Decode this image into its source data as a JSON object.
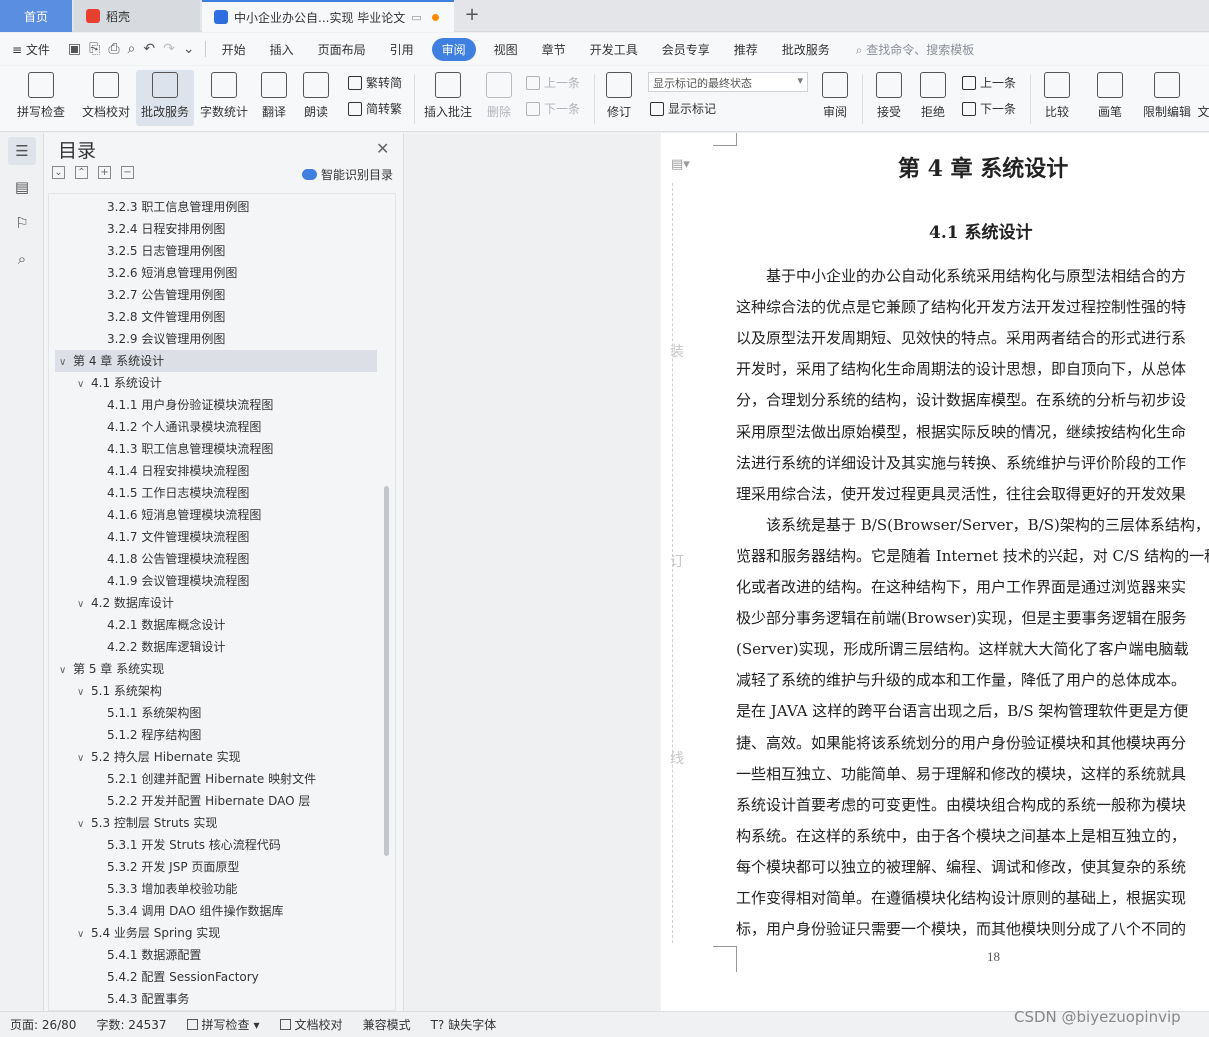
{
  "tabs": {
    "home": "首页",
    "daoke": "稻壳",
    "doc": "中小企业办公自...实现 毕业论文"
  },
  "menu": {
    "file": "文件",
    "items": [
      "开始",
      "插入",
      "页面布局",
      "引用",
      "审阅",
      "视图",
      "章节",
      "开发工具",
      "会员专享",
      "推荐",
      "批改服务"
    ],
    "active": "审阅",
    "search": "查找命令、搜索模板"
  },
  "ribbon": {
    "spell": "拼写检查",
    "proofread": "文档校对",
    "correction": "批改服务",
    "wordcount": "字数统计",
    "translate": "翻译",
    "read": "朗读",
    "to_simplified": "繁转简",
    "to_traditional": "简转繁",
    "insert_comment": "插入批注",
    "delete": "删除",
    "prev": "上一条",
    "next": "下一条",
    "revise": "修订",
    "markup_state": "显示标记的最终状态",
    "show_markup": "显示标记",
    "review": "审阅",
    "accept": "接受",
    "reject": "拒绝",
    "prev2": "上一条",
    "next2": "下一条",
    "compare": "比较",
    "pen": "画笔",
    "restrict": "限制编辑",
    "more": "文"
  },
  "toc": {
    "title": "目录",
    "smart": "智能识别目录",
    "items": [
      {
        "level": 3,
        "text": "3.2.3  职工信息管理用例图"
      },
      {
        "level": 3,
        "text": "3.2.4  日程安排用例图"
      },
      {
        "level": 3,
        "text": "3.2.5  日志管理用例图"
      },
      {
        "level": 3,
        "text": "3.2.6  短消息管理用例图"
      },
      {
        "level": 3,
        "text": "3.2.7  公告管理用例图"
      },
      {
        "level": 3,
        "text": "3.2.8  文件管理用例图"
      },
      {
        "level": 3,
        "text": "3.2.9  会议管理用例图"
      },
      {
        "level": 1,
        "text": "第 4 章  系统设计",
        "selected": true
      },
      {
        "level": 2,
        "text": "4.1  系统设计"
      },
      {
        "level": 3,
        "text": "4.1.1  用户身份验证模块流程图"
      },
      {
        "level": 3,
        "text": "4.1.2  个人通讯录模块流程图"
      },
      {
        "level": 3,
        "text": "4.1.3  职工信息管理模块流程图"
      },
      {
        "level": 3,
        "text": "4.1.4  日程安排模块流程图"
      },
      {
        "level": 3,
        "text": "4.1.5  工作日志模块流程图"
      },
      {
        "level": 3,
        "text": "4.1.6  短消息管理模块流程图"
      },
      {
        "level": 3,
        "text": "4.1.7  文件管理模块流程图"
      },
      {
        "level": 3,
        "text": "4.1.8  公告管理模块流程图"
      },
      {
        "level": 3,
        "text": "4.1.9  会议管理模块流程图"
      },
      {
        "level": 2,
        "text": "4.2  数据库设计"
      },
      {
        "level": 3,
        "text": "4.2.1  数据库概念设计"
      },
      {
        "level": 3,
        "text": "4.2.2  数据库逻辑设计"
      },
      {
        "level": 1,
        "text": "第 5 章  系统实现"
      },
      {
        "level": 2,
        "text": "5.1  系统架构"
      },
      {
        "level": 3,
        "text": "5.1.1  系统架构图"
      },
      {
        "level": 3,
        "text": "5.1.2  程序结构图"
      },
      {
        "level": 2,
        "text": "5.2  持久层 Hibernate 实现"
      },
      {
        "level": 3,
        "text": "5.2.1  创建并配置 Hibernate 映射文件"
      },
      {
        "level": 3,
        "text": "5.2.2  开发并配置 Hibernate DAO 层"
      },
      {
        "level": 2,
        "text": "5.3  控制层 Struts 实现"
      },
      {
        "level": 3,
        "text": "5.3.1  开发 Struts 核心流程代码"
      },
      {
        "level": 3,
        "text": "5.3.2  开发 JSP 页面原型"
      },
      {
        "level": 3,
        "text": "5.3.3  增加表单校验功能"
      },
      {
        "level": 3,
        "text": "5.3.4  调用 DAO 组件操作数据库"
      },
      {
        "level": 2,
        "text": "5.4  业务层 Spring 实现"
      },
      {
        "level": 3,
        "text": "5.4.1  数据源配置"
      },
      {
        "level": 3,
        "text": "5.4.2  配置 SessionFactory"
      },
      {
        "level": 3,
        "text": "5.4.3  配置事务"
      }
    ]
  },
  "document": {
    "chapter": "第 4 章  系统设计",
    "section": "4.1  系统设计",
    "binding": [
      "装",
      "订",
      "线"
    ],
    "lines": [
      "　　基于中小企业的办公自动化系统采用结构化与原型法相结合的方",
      "这种综合法的优点是它兼顾了结构化开发方法开发过程控制性强的特",
      "以及原型法开发周期短、见效快的特点。采用两者结合的形式进行系",
      "开发时，采用了结构化生命周期法的设计思想，即自顶向下，从总体",
      "分，合理划分系统的结构，设计数据库模型。在系统的分析与初步设",
      "采用原型法做出原始模型，根据实际反映的情况，继续按结构化生命",
      "法进行系统的详细设计及其实施与转换、系统维护与评价阶段的工作",
      "理采用综合法，使开发过程更具灵活性，往往会取得更好的开发效果",
      "　　该系统是基于 B/S(Browser/Server，B/S)架构的三层体系结构，",
      "览器和服务器结构。它是随着 Internet 技术的兴起，对 C/S 结构的一种",
      "化或者改进的结构。在这种结构下，用户工作界面是通过浏览器来实",
      "极少部分事务逻辑在前端(Browser)实现，但是主要事务逻辑在服务",
      "(Server)实现，形成所谓三层结构。这样就大大简化了客户端电脑载",
      "减轻了系统的维护与升级的成本和工作量，降低了用户的总体成本。",
      "是在 JAVA 这样的跨平台语言出现之后，B/S 架构管理软件更是方便",
      "捷、高效。如果能将该系统划分的用户身份验证模块和其他模块再分",
      "一些相互独立、功能简单、易于理解和修改的模块，这样的系统就具",
      "系统设计首要考虑的可变更性。由模块组合构成的系统一般称为模块",
      "构系统。在这样的系统中，由于各个模块之间基本上是相互独立的，",
      "每个模块都可以独立的被理解、编程、调试和修改，使其复杂的系统",
      "工作变得相对简单。在遵循模块化结构设计原则的基础上，根据实现",
      "标，用户身份验证只需要一个模块，而其他模块则分成了八个不同的"
    ],
    "page_number": "18"
  },
  "status": {
    "page": "页面: 26/80",
    "words": "字数: 24537",
    "spell": "拼写检查",
    "proof": "文档校对",
    "compat": "兼容模式",
    "missing_font": "缺失字体"
  },
  "watermark": "CSDN @biyezuopinvip",
  "colors": {
    "accent": "#3f7fe0",
    "home_tab": "#5a8ee0"
  }
}
